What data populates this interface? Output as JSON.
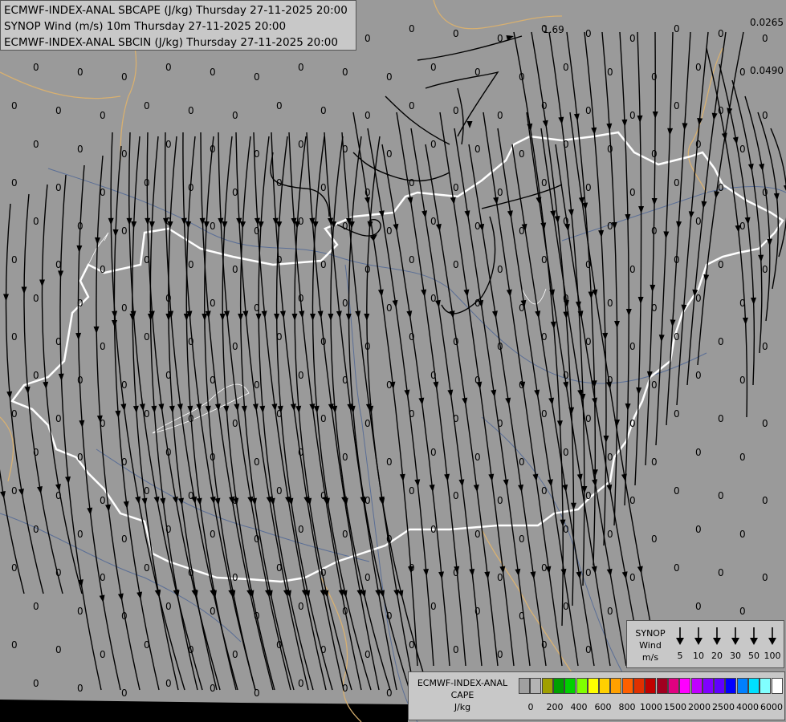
{
  "titles": [
    "ECMWF-INDEX-ANAL SBCAPE (J/kg) Thursday 27-11-2025 20:00",
    "SYNOP Wind (m/s) 10m Thursday 27-11-2025 20:00",
    "ECMWF-INDEX-ANAL SBCIN (J/kg) Thursday 27-11-2025 20:00"
  ],
  "map_labels": {
    "zero": "0",
    "v169": "1.69",
    "v0265": "0.0265",
    "v0490": "0.0490"
  },
  "synop_legend": {
    "title_lines": [
      "SYNOP",
      "Wind",
      "m/s"
    ],
    "values": [
      "5",
      "10",
      "20",
      "30",
      "50",
      "100"
    ]
  },
  "cape_legend": {
    "title_lines": [
      "ECMWF-INDEX-ANAL",
      "CAPE",
      "J/kg"
    ],
    "colors": [
      "#a0a0a0",
      "#b4b4b4",
      "#a0a000",
      "#00a000",
      "#00d000",
      "#80ff00",
      "#ffff00",
      "#ffd000",
      "#ffa000",
      "#ff6000",
      "#e03000",
      "#c00000",
      "#a00020",
      "#e00080",
      "#ff00ff",
      "#c000ff",
      "#8000ff",
      "#6000ff",
      "#0000ff",
      "#0080ff",
      "#00e0ff",
      "#80ffff",
      "#ffffff"
    ],
    "ticks": [
      "0",
      "200",
      "400",
      "600",
      "800",
      "1000",
      "1500",
      "2000",
      "2500",
      "4000",
      "6000"
    ]
  },
  "colors": {
    "background": "#9a9a9a",
    "streamline": "#000000",
    "country_border": "#ffffff",
    "neighbor_border": "#d8b070",
    "river": "#5a6e96"
  }
}
